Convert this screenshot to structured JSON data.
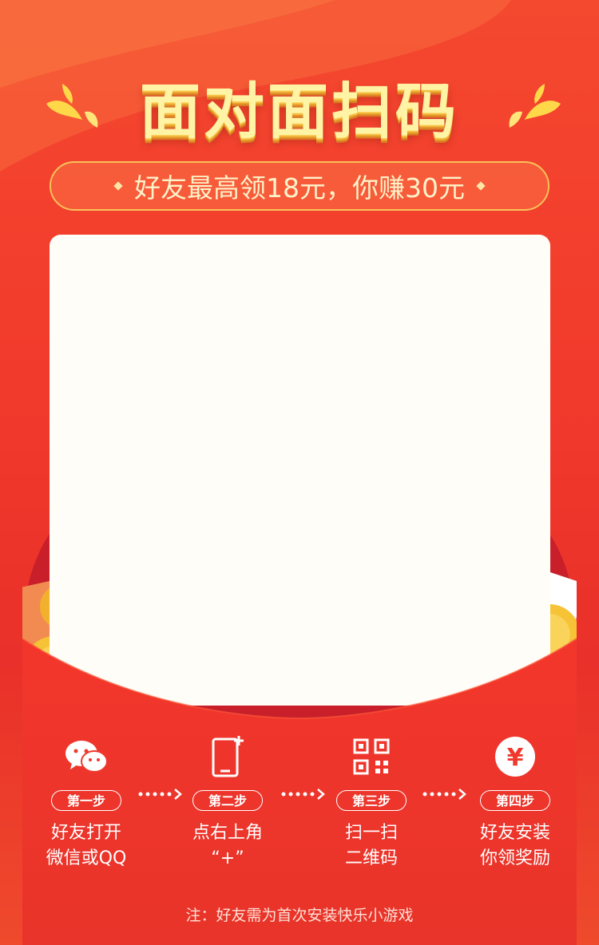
{
  "header": {
    "title": "面对面扫码",
    "subtitle": "好友最高领18元，你赚30元"
  },
  "steps": [
    {
      "badge": "第一步",
      "line1": "好友打开",
      "line2": "微信或QQ",
      "icon": "wechat-icon"
    },
    {
      "badge": "第二步",
      "line1": "点右上角",
      "line2": "“+”",
      "icon": "phone-plus-icon"
    },
    {
      "badge": "第三步",
      "line1": "扫一扫",
      "line2": "二维码",
      "icon": "qr-code-icon"
    },
    {
      "badge": "第四步",
      "line1": "好友安装",
      "line2": "你领奖励",
      "icon": "yuan-coin-icon"
    }
  ],
  "footer": {
    "note": "注：好友需为首次安装快乐小游戏"
  },
  "colors": {
    "background": "#f23a2c",
    "title": "#fff3a6",
    "card": "#fffdf7",
    "coin": "#f6c236"
  }
}
